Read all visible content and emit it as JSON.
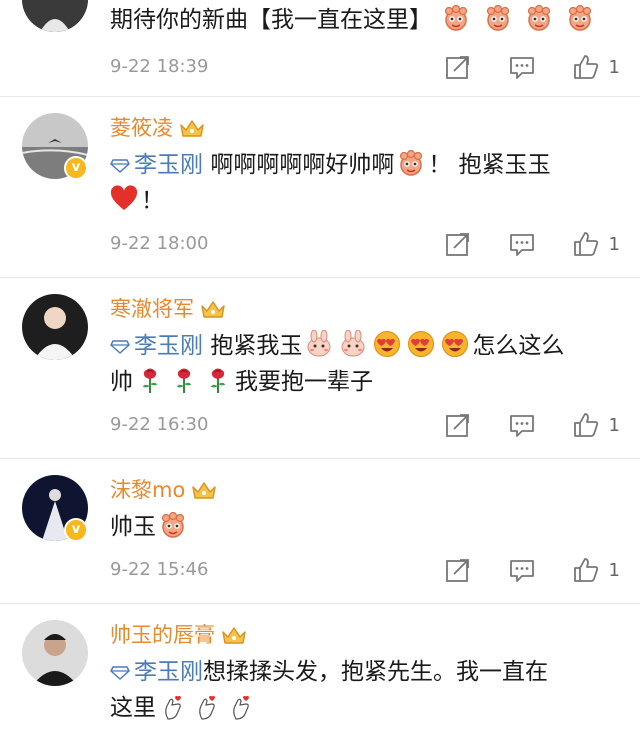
{
  "colors": {
    "username": "#e8892e",
    "mention": "#4b7bb8",
    "meta": "#999999",
    "badge": "#f6b81c"
  },
  "comments": [
    {
      "username": "",
      "text_before": "期待你的新曲【我一直在这里】",
      "mention": "",
      "text": "",
      "time": "9-22 18:39",
      "likes": "1"
    },
    {
      "username": "菱筱凌",
      "mention": "李玉刚",
      "text": "啊啊啊啊啊好帅啊",
      "text_after_emoji": "！ 抱紧玉玉",
      "text_end": "！",
      "time": "9-22 18:00",
      "likes": "1"
    },
    {
      "username": "寒澈将军",
      "mention": "李玉刚",
      "text": "抱紧我玉",
      "text_after_emoji": "怎么这么",
      "text_line2a": "帅",
      "text_line2b": "我要抱一辈子",
      "time": "9-22 16:30",
      "likes": "1"
    },
    {
      "username": "沫黎mo",
      "text": "帅玉",
      "time": "9-22 15:46",
      "likes": "1"
    },
    {
      "username": "帅玉的唇膏",
      "mention": "李玉刚",
      "text": "想揉揉头发，抱紧先生。我一直在",
      "text_line2": "这里"
    }
  ]
}
